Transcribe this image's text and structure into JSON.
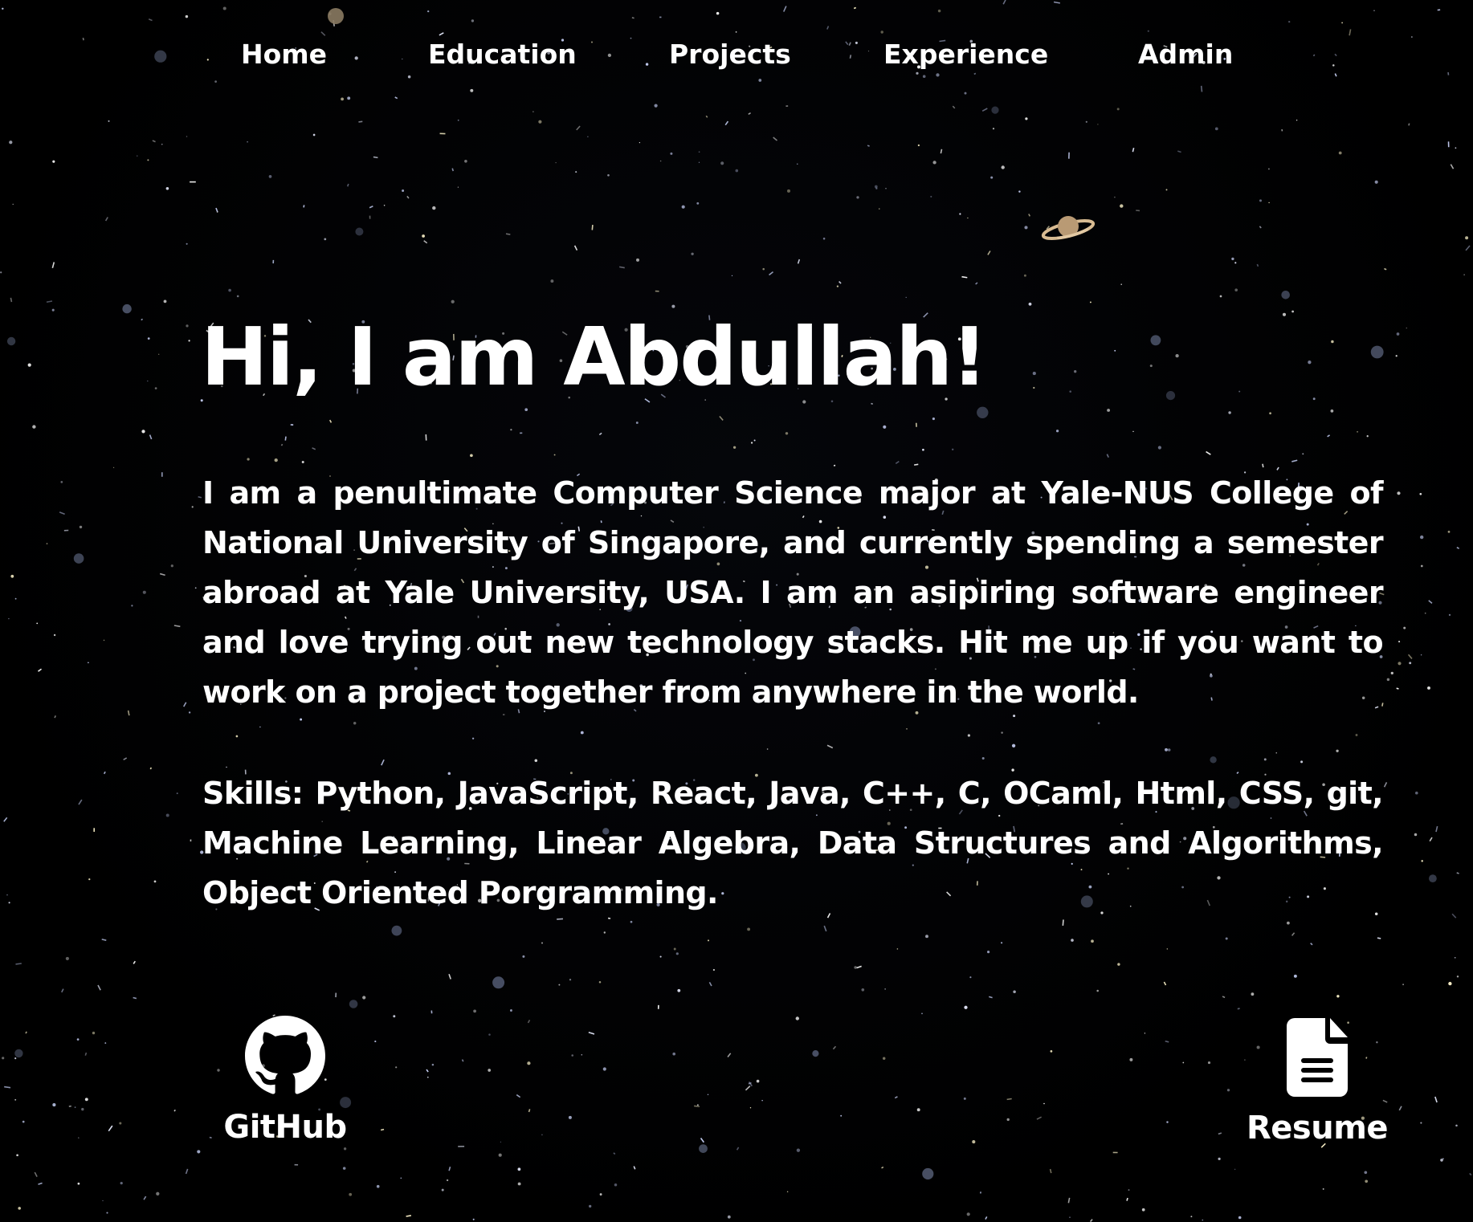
{
  "nav": {
    "items": [
      {
        "label": "Home"
      },
      {
        "label": "Education"
      },
      {
        "label": "Projects"
      },
      {
        "label": "Experience"
      },
      {
        "label": "Admin"
      }
    ]
  },
  "hero": {
    "title": "Hi, I am Abdullah!",
    "intro": "I am a penultimate Computer Science major at Yale-NUS College of National University of Singapore, and currently spending a semester abroad at Yale University, USA. I am an asipiring software engineer and love trying out new technology stacks. Hit me up if you want to work on a project together from anywhere in the world.",
    "skills": "Skills: Python, JavaScript, React, Java, C++, C, OCaml, Html, CSS, git, Machine Learning, Linear Algebra, Data Structures and Algorithms, Object Oriented Porgramming."
  },
  "links": {
    "github": {
      "label": "GitHub",
      "icon": "github-icon"
    },
    "resume": {
      "label": "Resume",
      "icon": "document-icon"
    }
  },
  "theme": {
    "background": "#000000",
    "text": "#ffffff",
    "planet": "#c9a77c"
  }
}
